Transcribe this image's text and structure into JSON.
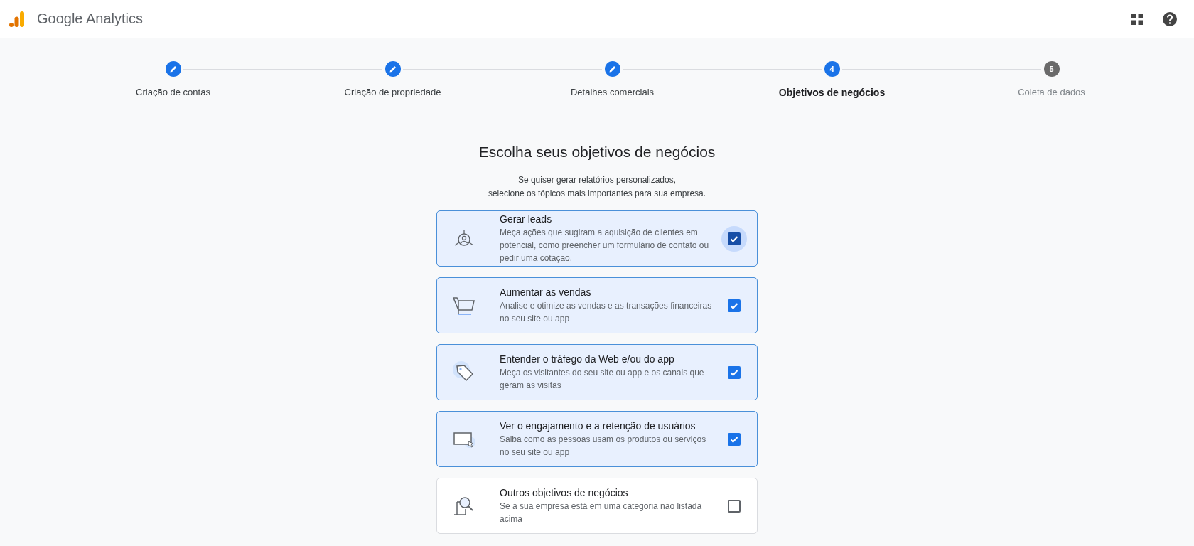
{
  "header": {
    "product_name": "Google Analytics"
  },
  "steps": [
    {
      "label": "Criação de contas",
      "completed": true,
      "selected": false
    },
    {
      "label": "Criação de propriedade",
      "completed": true,
      "selected": false
    },
    {
      "label": "Detalhes comerciais",
      "completed": true,
      "selected": false
    },
    {
      "number": "4",
      "label": "Objetivos de negócios",
      "completed": false,
      "selected": true
    },
    {
      "number": "5",
      "label": "Coleta de dados",
      "completed": false,
      "selected": false
    }
  ],
  "heading": "Escolha seus objetivos de negócios",
  "subtitle_lines": [
    "Se quiser gerar relatórios personalizados,",
    "selecione os tópicos mais importantes para sua empresa."
  ],
  "objectives": [
    {
      "kind": "leads",
      "title": "Gerar leads",
      "description": "Meça ações que sugiram a aquisição de clientes em potencial, como preencher um formulário de contato ou pedir uma cotação.",
      "checked": true,
      "focused": true
    },
    {
      "kind": "sales",
      "title": "Aumentar as vendas",
      "description": "Analise e otimize as vendas e as transações financeiras no seu site ou app",
      "checked": true,
      "focused": false
    },
    {
      "kind": "traffic",
      "title": "Entender o tráfego da Web e/ou do app",
      "description": "Meça os visitantes do seu site ou app e os canais que geram as visitas",
      "checked": true,
      "focused": false
    },
    {
      "kind": "engagement",
      "title": "Ver o engajamento e a retenção de usuários",
      "description": "Saiba como as pessoas usam os produtos ou serviços no seu site ou app",
      "checked": true,
      "focused": false
    },
    {
      "kind": "other",
      "title": "Outros objetivos de negócios",
      "description": "Se a sua empresa está em uma categoria não listada acima",
      "checked": false,
      "focused": false
    }
  ]
}
